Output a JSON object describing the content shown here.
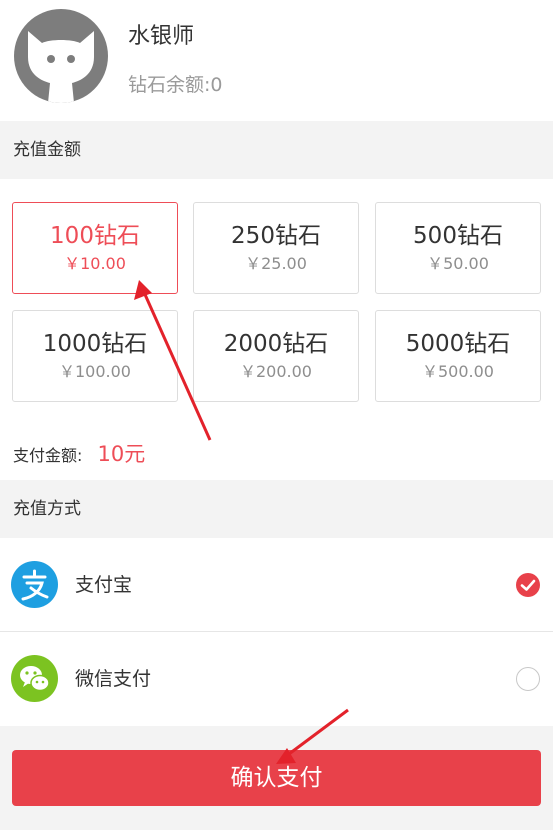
{
  "profile": {
    "username": "水银师",
    "balance": "钻石余额:0"
  },
  "recharge_amount": {
    "title": "充值金额",
    "options": [
      {
        "diamonds": "100钻石",
        "price": "￥10.00"
      },
      {
        "diamonds": "250钻石",
        "price": "￥25.00"
      },
      {
        "diamonds": "500钻石",
        "price": "￥50.00"
      },
      {
        "diamonds": "1000钻石",
        "price": "￥100.00"
      },
      {
        "diamonds": "2000钻石",
        "price": "￥200.00"
      },
      {
        "diamonds": "5000钻石",
        "price": "￥500.00"
      }
    ],
    "pay_label": "支付金额:",
    "pay_value": "10元"
  },
  "recharge_method": {
    "title": "充值方式",
    "methods": [
      {
        "name": "支付宝",
        "icon": "alipay-icon",
        "selected": true
      },
      {
        "name": "微信支付",
        "icon": "wechat-pay-icon",
        "selected": false
      }
    ]
  },
  "confirm_label": "确认支付",
  "colors": {
    "accent": "#e8414a",
    "alipay": "#1e9fe1",
    "wechat": "#7cc321",
    "annotation": "#e3222b"
  }
}
